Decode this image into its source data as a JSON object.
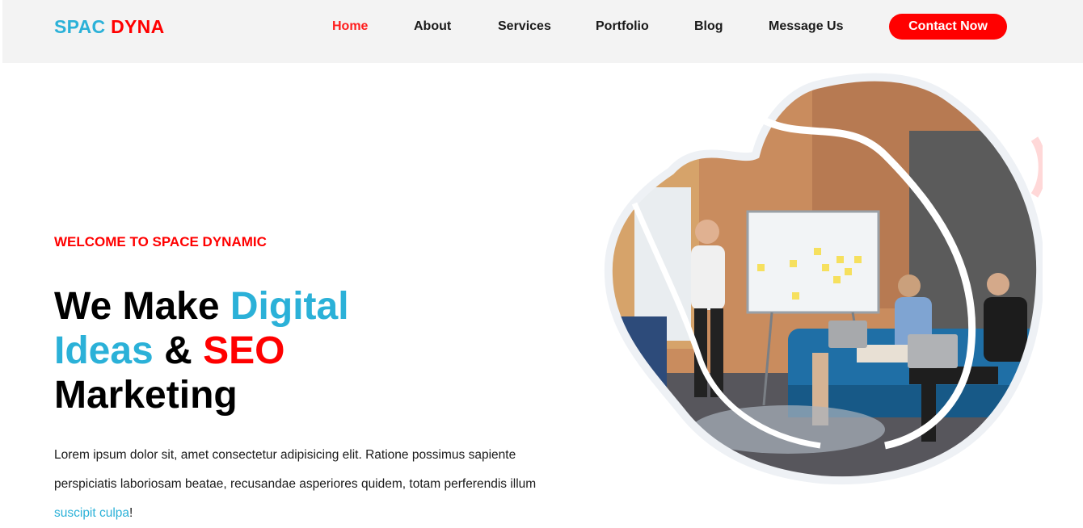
{
  "header": {
    "logo_part1": "SPAC",
    "logo_part2": "DYNA",
    "nav": [
      {
        "label": "Home",
        "active": true
      },
      {
        "label": "About"
      },
      {
        "label": "Services"
      },
      {
        "label": "Portfolio"
      },
      {
        "label": "Blog"
      },
      {
        "label": "Message Us"
      }
    ],
    "cta_label": "Contact Now"
  },
  "hero": {
    "eyebrow": "WELCOME TO SPACE DYNAMIC",
    "headline": {
      "w1": "We Make",
      "w2": "Digital",
      "w3": "Ideas",
      "w4": "&",
      "w5": "SEO",
      "w6": "Marketing"
    },
    "intro_text": "Lorem ipsum dolor sit, amet consectetur adipisicing elit. Ratione possimus sapiente perspiciatis laboriosam beatae, recusandae asperiores quidem, totam perferendis illum",
    "intro_link": "suscipit culpa",
    "intro_end": "!"
  },
  "colors": {
    "blue": "#2bb1d8",
    "red": "#ff0000",
    "nav_bg": "#f3f3f3"
  }
}
